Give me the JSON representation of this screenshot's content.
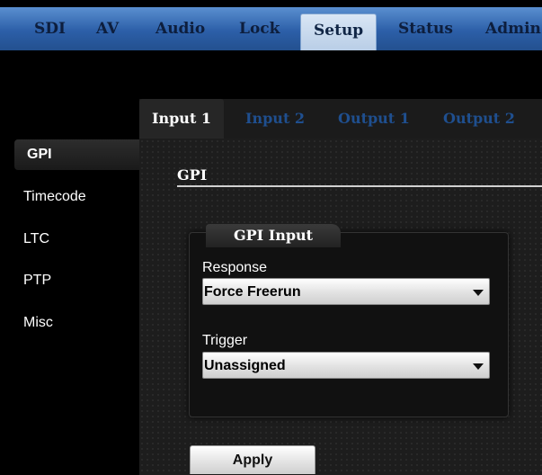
{
  "topnav": {
    "tabs": [
      {
        "label": "SDI"
      },
      {
        "label": "AV"
      },
      {
        "label": "Audio"
      },
      {
        "label": "Lock"
      },
      {
        "label": "Setup",
        "active": true
      },
      {
        "label": "Status"
      },
      {
        "label": "Admin"
      }
    ]
  },
  "subtabs": [
    {
      "label": "Input 1",
      "active": true
    },
    {
      "label": "Input 2"
    },
    {
      "label": "Output 1"
    },
    {
      "label": "Output 2"
    }
  ],
  "sidebar": {
    "items": [
      {
        "label": "GPI",
        "active": true
      },
      {
        "label": "Timecode"
      },
      {
        "label": "LTC"
      },
      {
        "label": "PTP"
      },
      {
        "label": "Misc"
      }
    ]
  },
  "section": {
    "title": "GPI"
  },
  "group": {
    "legend": "GPI Input",
    "response": {
      "label": "Response",
      "value": "Force Freerun"
    },
    "trigger": {
      "label": "Trigger",
      "value": "Unassigned"
    }
  },
  "apply_label": "Apply",
  "colors": {
    "nav_blue": "#2c5fa8",
    "inactive_tab_text": "#1f4f8f",
    "background": "#000000"
  }
}
